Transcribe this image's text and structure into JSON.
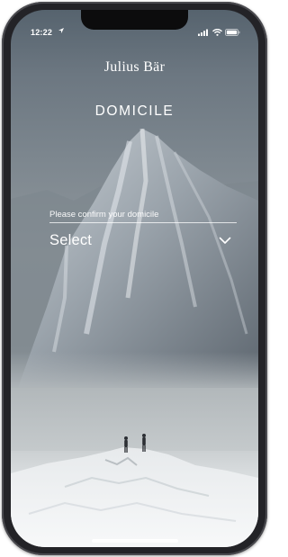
{
  "status_bar": {
    "time": "12:22",
    "location_icon": "location-arrow-icon",
    "signal_icon": "cellular-signal-icon",
    "wifi_icon": "wifi-icon",
    "battery_icon": "battery-icon"
  },
  "header": {
    "brand": "Julius Bär",
    "title": "DOMICILE"
  },
  "domicile_form": {
    "label": "Please confirm your domicile",
    "selected_value": "Select",
    "chevron_icon": "chevron-down-icon"
  },
  "background_image": "snowy-mountain-with-two-hikers",
  "colors": {
    "text": "#ffffff",
    "device_frame": "#232327"
  }
}
